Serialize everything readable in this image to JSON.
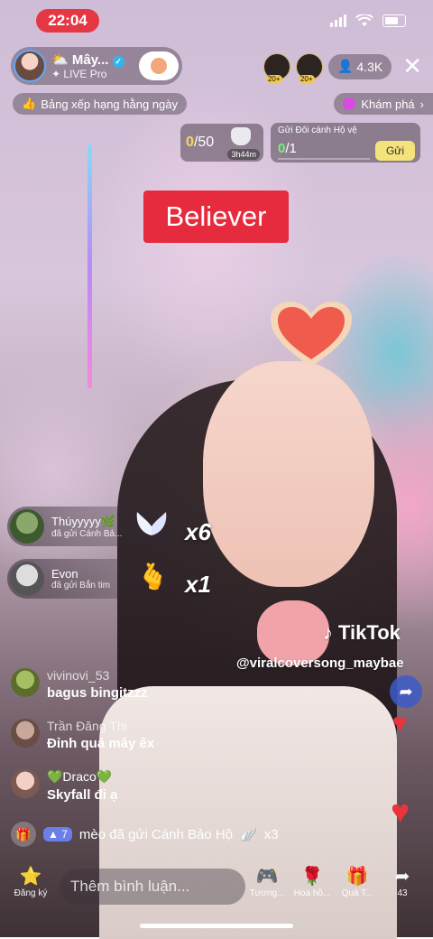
{
  "status_bar": {
    "time": "22:04"
  },
  "host": {
    "name": "Mây...",
    "subtitle": "LIVE Pro"
  },
  "viewers": {
    "count": "4.3K",
    "badge_1": "20+",
    "badge_2": "20+"
  },
  "daily_rank": {
    "label": "Bảng xếp hạng hằng ngày"
  },
  "explore": {
    "label": "Khám phá"
  },
  "goal": {
    "current": "0",
    "total": "/50",
    "timer": "3h44m"
  },
  "guard": {
    "title": "Gửi Đôi cánh Hộ vệ",
    "current": "0",
    "total": "/1",
    "send_label": "Gửi"
  },
  "song_title": "Believer",
  "gifts": [
    {
      "name": "Thúyyyyy🌿",
      "action": "đã gửi Cánh Bả...",
      "combo": "x6"
    },
    {
      "name": "Evon",
      "action": "đã gửi Bắn tim",
      "combo": "x1"
    }
  ],
  "watermark": {
    "brand": "TikTok",
    "username": "@viralcoversong_maybae"
  },
  "comments": [
    {
      "user": "vivinovi_53",
      "text": "bagus bingitzzz"
    },
    {
      "user": "Trần Đăng Thi",
      "text": "Đỉnh quá mây êx"
    },
    {
      "user": "💚Draco💚",
      "text": "Skyfall đi ạ"
    }
  ],
  "gift_banner": {
    "level": "7",
    "text": "mèo đã gửi Cánh Bảo Hộ",
    "count": "x3"
  },
  "bottom": {
    "subscribe": "Đăng ký",
    "comment_placeholder": "Thêm bình luận...",
    "interact": "Tương...",
    "rose": "Hoa hồ...",
    "gift": "Quà T...",
    "share_count": "43"
  }
}
